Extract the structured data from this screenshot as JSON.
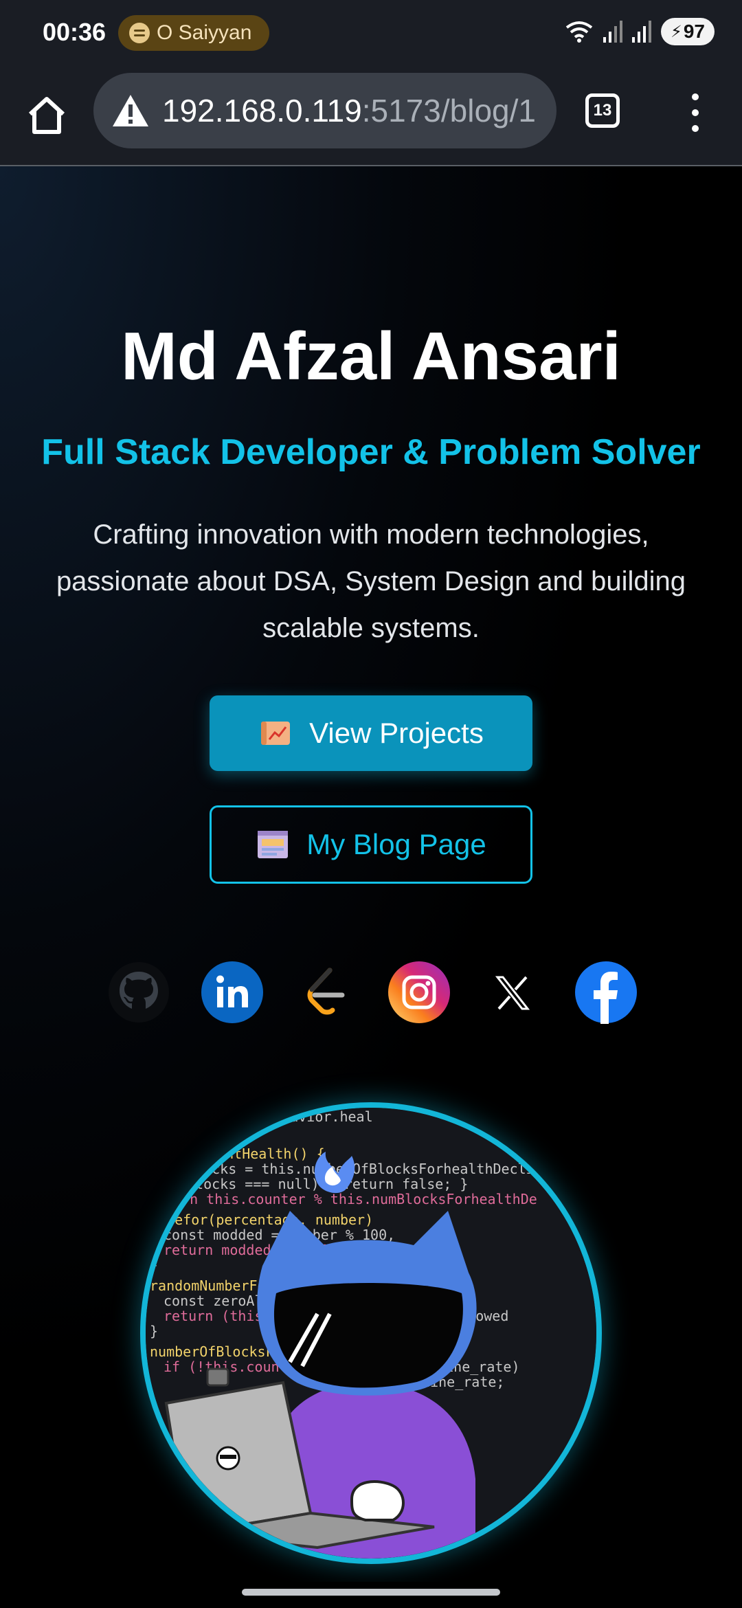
{
  "status_bar": {
    "time": "00:36",
    "media_track": "O Saiyyan",
    "battery": "97"
  },
  "browser": {
    "url_host": "192.168.0.119",
    "url_rest": ":5173/blog/1",
    "tab_count": "13"
  },
  "hero": {
    "name": "Md Afzal Ansari",
    "tagline": "Full Stack Developer & Problem Solver",
    "description": "Crafting innovation with modern technologies, passionate about DSA, System Design and building scalable systems.",
    "primary_button": "View Projects",
    "secondary_button": "My Blog Page"
  },
  "socials": [
    {
      "icon": "github-icon"
    },
    {
      "icon": "linkedin-icon"
    },
    {
      "icon": "leetcode-icon"
    },
    {
      "icon": "instagram-icon"
    },
    {
      "icon": "x-icon"
    },
    {
      "icon": "facebook-icon"
    }
  ],
  "colors": {
    "accent": "#13c2e8",
    "primary_button": "#0a93bb",
    "background": "#000000"
  }
}
